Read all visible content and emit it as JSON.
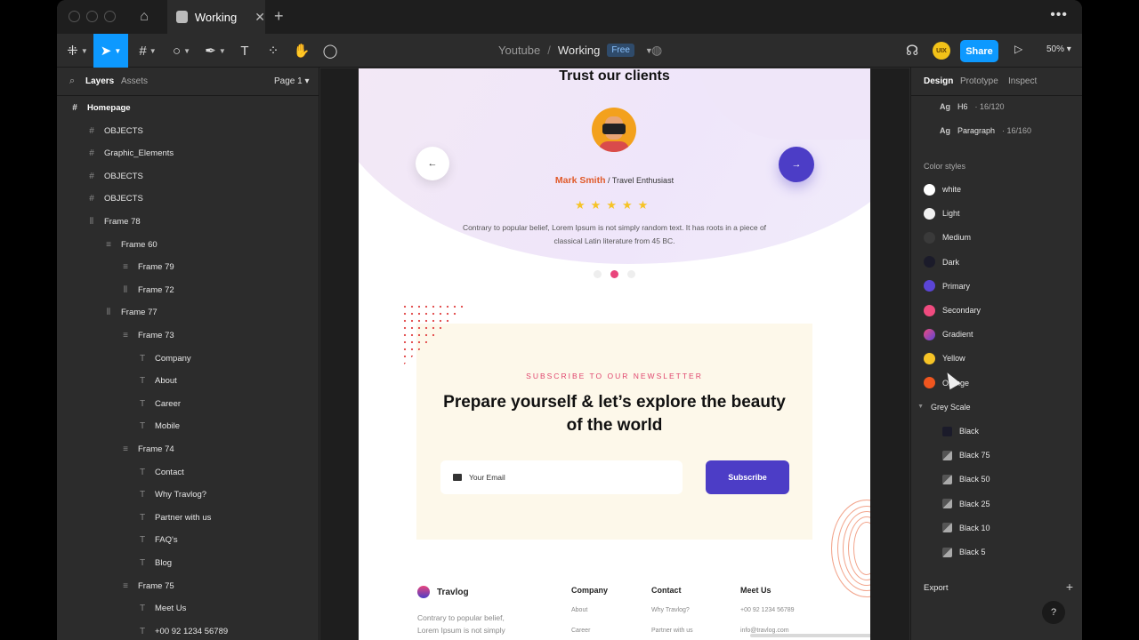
{
  "tab": {
    "title": "Working"
  },
  "breadcrumb": {
    "team": "Youtube",
    "separator": "/",
    "file": "Working",
    "plan": "Free"
  },
  "toolbar": {
    "share": "Share",
    "zoom": "50%",
    "avatar": "UIX"
  },
  "left_panel": {
    "tab_layers": "Layers",
    "tab_assets": "Assets",
    "page": "Page 1",
    "layers": [
      {
        "label": "Homepage",
        "icon": "frame",
        "indent": 0,
        "root": true
      },
      {
        "label": "OBJECTS",
        "icon": "frame",
        "indent": 1
      },
      {
        "label": "Graphic_Elements",
        "icon": "frame",
        "indent": 1
      },
      {
        "label": "OBJECTS",
        "icon": "frame",
        "indent": 1
      },
      {
        "label": "OBJECTS",
        "icon": "frame",
        "indent": 1
      },
      {
        "label": "Frame 78",
        "icon": "autolayout-v",
        "indent": 1
      },
      {
        "label": "Frame 60",
        "icon": "autolayout-h",
        "indent": 2
      },
      {
        "label": "Frame 79",
        "icon": "autolayout-h",
        "indent": 3
      },
      {
        "label": "Frame 72",
        "icon": "autolayout-v",
        "indent": 3
      },
      {
        "label": "Frame 77",
        "icon": "autolayout-v",
        "indent": 2
      },
      {
        "label": "Frame 73",
        "icon": "autolayout-h",
        "indent": 3
      },
      {
        "label": "Company",
        "icon": "text",
        "indent": 4
      },
      {
        "label": "About",
        "icon": "text",
        "indent": 4
      },
      {
        "label": "Career",
        "icon": "text",
        "indent": 4
      },
      {
        "label": "Mobile",
        "icon": "text",
        "indent": 4
      },
      {
        "label": "Frame 74",
        "icon": "autolayout-h",
        "indent": 3
      },
      {
        "label": "Contact",
        "icon": "text",
        "indent": 4
      },
      {
        "label": "Why Travlog?",
        "icon": "text",
        "indent": 4
      },
      {
        "label": "Partner with us",
        "icon": "text",
        "indent": 4
      },
      {
        "label": "FAQ's",
        "icon": "text",
        "indent": 4
      },
      {
        "label": "Blog",
        "icon": "text",
        "indent": 4
      },
      {
        "label": "Frame 75",
        "icon": "autolayout-h",
        "indent": 3
      },
      {
        "label": "Meet Us",
        "icon": "text",
        "indent": 4
      },
      {
        "label": "+00 92 1234 56789",
        "icon": "text",
        "indent": 4
      }
    ]
  },
  "canvas": {
    "section_title": "Trust our clients",
    "reviewer_name": "Mark Smith",
    "reviewer_role": "/ Travel Enthusiast",
    "rating": 5,
    "quote": "Contrary to popular belief, Lorem Ipsum is not simply random text. It has roots in a piece of classical Latin literature from 45 BC.",
    "prev_arrow": "←",
    "next_arrow": "→",
    "newsletter_kicker": "SUBSCRIBE TO OUR NEWSLETTER",
    "newsletter_title": "Prepare yourself & let’s explore the beauty of the world",
    "email_placeholder": "Your Email",
    "subscribe_label": "Subscribe",
    "footer": {
      "brand": "Travlog",
      "description": "Contrary to popular belief, Lorem Ipsum is not simply",
      "columns": [
        {
          "heading": "Company",
          "items": [
            "About",
            "Career"
          ]
        },
        {
          "heading": "Contact",
          "items": [
            "Why Travlog?",
            "Partner with us"
          ]
        },
        {
          "heading": "Meet Us",
          "items": [
            "+00 92 1234 56789",
            "info@travlog.com"
          ]
        }
      ]
    }
  },
  "right_panel": {
    "tabs": [
      "Design",
      "Prototype",
      "Inspect"
    ],
    "text_styles": [
      {
        "glyph": "Ag",
        "name": "H6",
        "meta": "· 16/120"
      },
      {
        "glyph": "Ag",
        "name": "Paragraph",
        "meta": "· 16/160"
      }
    ],
    "color_styles_title": "Color styles",
    "color_styles": [
      {
        "name": "white",
        "color": "#ffffff"
      },
      {
        "name": "Light",
        "color": "#f0f0f0"
      },
      {
        "name": "Medium",
        "color": "#3a3a3a"
      },
      {
        "name": "Dark",
        "color": "#1b1b2a"
      },
      {
        "name": "Primary",
        "color": "#5b45d6"
      },
      {
        "name": "Secondary",
        "color": "#ef4b7f"
      },
      {
        "name": "Gradient",
        "color": "#9b4bc4"
      },
      {
        "name": "Yellow",
        "color": "#f6c326"
      },
      {
        "name": "Orange",
        "color": "#f0561f"
      }
    ],
    "group_name": "Grey Scale",
    "grey_scale": [
      "Black",
      "Black 75",
      "Black 50",
      "Black 25",
      "Black 10",
      "Black 5"
    ],
    "export_label": "Export",
    "help": "?"
  }
}
